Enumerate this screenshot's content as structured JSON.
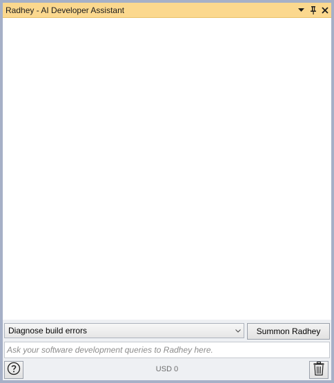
{
  "window": {
    "title": "Radhey - AI Developer Assistant"
  },
  "controls": {
    "selected_action": "Diagnose build errors",
    "summon_label": "Summon Radhey",
    "query_placeholder": "Ask your software development queries to Radhey here.",
    "cost_text": "USD 0"
  },
  "icons": {
    "dropdown": "chevron-down-icon",
    "pin": "pin-icon",
    "close": "close-icon",
    "select_chevron": "chevron-down-icon",
    "help": "help-icon",
    "trash": "trash-icon"
  },
  "colors": {
    "titlebar": "#fbd88e",
    "frame": "#a6b0c7",
    "content": "#ffffff"
  }
}
